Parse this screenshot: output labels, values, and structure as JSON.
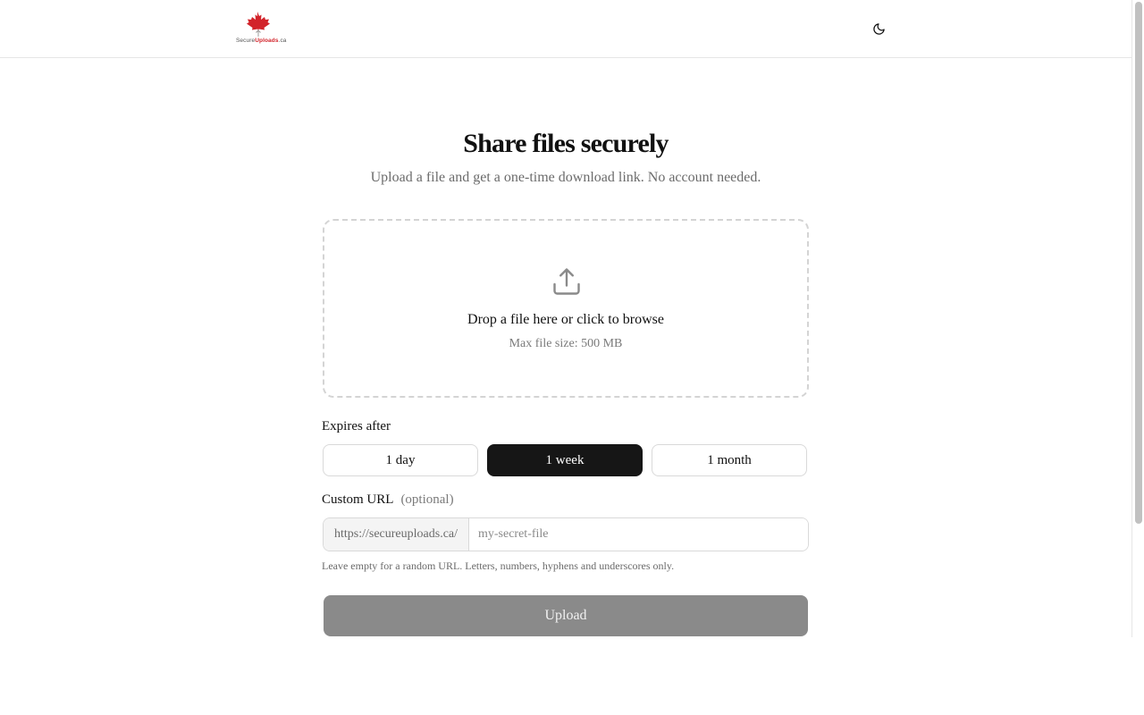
{
  "header": {
    "logo": {
      "text_secure": "Secure",
      "text_uploads": "Uploads",
      "text_ca": ".ca",
      "icon": "maple-leaf-icon",
      "brand_color": "#d2232a"
    },
    "theme_toggle_icon": "moon-icon"
  },
  "main": {
    "title": "Share files securely",
    "subtitle": "Upload a file and get a one-time download link. No account needed.",
    "dropzone": {
      "icon": "upload-icon",
      "title": "Drop a file here or click to browse",
      "max_size": "Max file size: 500 MB"
    },
    "expiry": {
      "label": "Expires after",
      "options": [
        "1 day",
        "1 week",
        "1 month"
      ],
      "selected": "1 week"
    },
    "custom_url": {
      "label": "Custom URL",
      "optional": "(optional)",
      "prefix": "https://secureuploads.ca/",
      "placeholder": "my-secret-file",
      "value": "",
      "help": "Leave empty for a random URL. Letters, numbers, hyphens and underscores only."
    },
    "upload_label": "Upload"
  },
  "colors": {
    "primary_active": "#161616",
    "upload_disabled": "#8a8a8a",
    "accent_red": "#d2232a"
  }
}
